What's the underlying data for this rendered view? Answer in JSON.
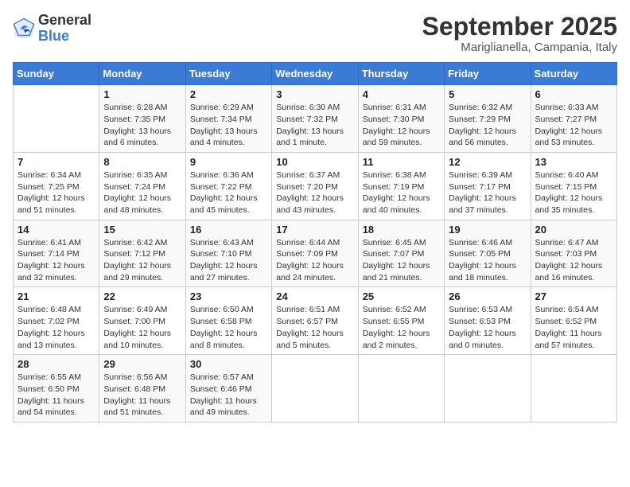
{
  "header": {
    "logo_general": "General",
    "logo_blue": "Blue",
    "month_title": "September 2025",
    "location": "Mariglianella, Campania, Italy"
  },
  "days_of_week": [
    "Sunday",
    "Monday",
    "Tuesday",
    "Wednesday",
    "Thursday",
    "Friday",
    "Saturday"
  ],
  "weeks": [
    [
      {
        "day": "",
        "info": ""
      },
      {
        "day": "1",
        "info": "Sunrise: 6:28 AM\nSunset: 7:35 PM\nDaylight: 13 hours\nand 6 minutes."
      },
      {
        "day": "2",
        "info": "Sunrise: 6:29 AM\nSunset: 7:34 PM\nDaylight: 13 hours\nand 4 minutes."
      },
      {
        "day": "3",
        "info": "Sunrise: 6:30 AM\nSunset: 7:32 PM\nDaylight: 13 hours\nand 1 minute."
      },
      {
        "day": "4",
        "info": "Sunrise: 6:31 AM\nSunset: 7:30 PM\nDaylight: 12 hours\nand 59 minutes."
      },
      {
        "day": "5",
        "info": "Sunrise: 6:32 AM\nSunset: 7:29 PM\nDaylight: 12 hours\nand 56 minutes."
      },
      {
        "day": "6",
        "info": "Sunrise: 6:33 AM\nSunset: 7:27 PM\nDaylight: 12 hours\nand 53 minutes."
      }
    ],
    [
      {
        "day": "7",
        "info": "Sunrise: 6:34 AM\nSunset: 7:25 PM\nDaylight: 12 hours\nand 51 minutes."
      },
      {
        "day": "8",
        "info": "Sunrise: 6:35 AM\nSunset: 7:24 PM\nDaylight: 12 hours\nand 48 minutes."
      },
      {
        "day": "9",
        "info": "Sunrise: 6:36 AM\nSunset: 7:22 PM\nDaylight: 12 hours\nand 45 minutes."
      },
      {
        "day": "10",
        "info": "Sunrise: 6:37 AM\nSunset: 7:20 PM\nDaylight: 12 hours\nand 43 minutes."
      },
      {
        "day": "11",
        "info": "Sunrise: 6:38 AM\nSunset: 7:19 PM\nDaylight: 12 hours\nand 40 minutes."
      },
      {
        "day": "12",
        "info": "Sunrise: 6:39 AM\nSunset: 7:17 PM\nDaylight: 12 hours\nand 37 minutes."
      },
      {
        "day": "13",
        "info": "Sunrise: 6:40 AM\nSunset: 7:15 PM\nDaylight: 12 hours\nand 35 minutes."
      }
    ],
    [
      {
        "day": "14",
        "info": "Sunrise: 6:41 AM\nSunset: 7:14 PM\nDaylight: 12 hours\nand 32 minutes."
      },
      {
        "day": "15",
        "info": "Sunrise: 6:42 AM\nSunset: 7:12 PM\nDaylight: 12 hours\nand 29 minutes."
      },
      {
        "day": "16",
        "info": "Sunrise: 6:43 AM\nSunset: 7:10 PM\nDaylight: 12 hours\nand 27 minutes."
      },
      {
        "day": "17",
        "info": "Sunrise: 6:44 AM\nSunset: 7:09 PM\nDaylight: 12 hours\nand 24 minutes."
      },
      {
        "day": "18",
        "info": "Sunrise: 6:45 AM\nSunset: 7:07 PM\nDaylight: 12 hours\nand 21 minutes."
      },
      {
        "day": "19",
        "info": "Sunrise: 6:46 AM\nSunset: 7:05 PM\nDaylight: 12 hours\nand 18 minutes."
      },
      {
        "day": "20",
        "info": "Sunrise: 6:47 AM\nSunset: 7:03 PM\nDaylight: 12 hours\nand 16 minutes."
      }
    ],
    [
      {
        "day": "21",
        "info": "Sunrise: 6:48 AM\nSunset: 7:02 PM\nDaylight: 12 hours\nand 13 minutes."
      },
      {
        "day": "22",
        "info": "Sunrise: 6:49 AM\nSunset: 7:00 PM\nDaylight: 12 hours\nand 10 minutes."
      },
      {
        "day": "23",
        "info": "Sunrise: 6:50 AM\nSunset: 6:58 PM\nDaylight: 12 hours\nand 8 minutes."
      },
      {
        "day": "24",
        "info": "Sunrise: 6:51 AM\nSunset: 6:57 PM\nDaylight: 12 hours\nand 5 minutes."
      },
      {
        "day": "25",
        "info": "Sunrise: 6:52 AM\nSunset: 6:55 PM\nDaylight: 12 hours\nand 2 minutes."
      },
      {
        "day": "26",
        "info": "Sunrise: 6:53 AM\nSunset: 6:53 PM\nDaylight: 12 hours\nand 0 minutes."
      },
      {
        "day": "27",
        "info": "Sunrise: 6:54 AM\nSunset: 6:52 PM\nDaylight: 11 hours\nand 57 minutes."
      }
    ],
    [
      {
        "day": "28",
        "info": "Sunrise: 6:55 AM\nSunset: 6:50 PM\nDaylight: 11 hours\nand 54 minutes."
      },
      {
        "day": "29",
        "info": "Sunrise: 6:56 AM\nSunset: 6:48 PM\nDaylight: 11 hours\nand 51 minutes."
      },
      {
        "day": "30",
        "info": "Sunrise: 6:57 AM\nSunset: 6:46 PM\nDaylight: 11 hours\nand 49 minutes."
      },
      {
        "day": "",
        "info": ""
      },
      {
        "day": "",
        "info": ""
      },
      {
        "day": "",
        "info": ""
      },
      {
        "day": "",
        "info": ""
      }
    ]
  ]
}
